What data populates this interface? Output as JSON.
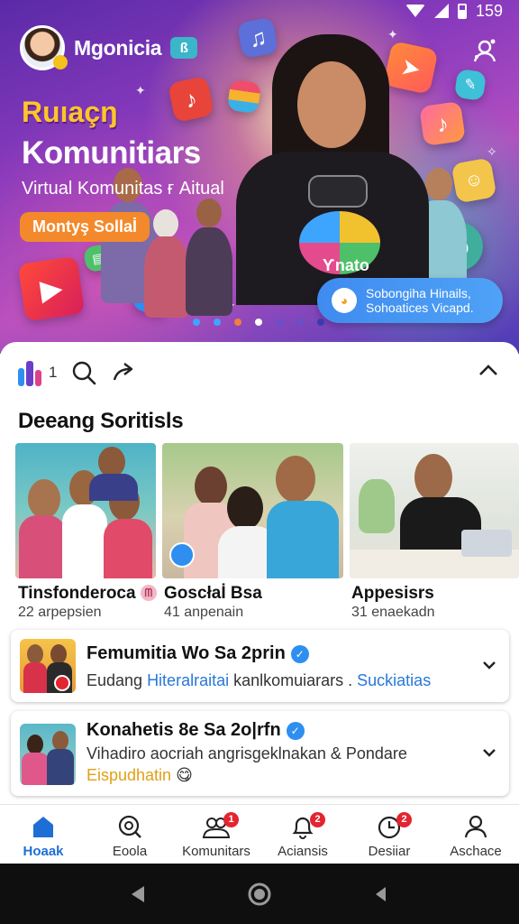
{
  "status_bar": {
    "time": "159"
  },
  "header": {
    "app_name": "Mgonicia",
    "badge_glyph": "ß"
  },
  "hero": {
    "title_line1": "Ruıaçŋ",
    "title_line2": "Komunitiars",
    "subtitle": "Virtual Komunitas ғ Aitual",
    "cta_label": "Montyş Sollaİ",
    "shirt_text": "Ƴnato",
    "card_text_line1": "Sobongiha Hinails,",
    "card_text_line2": "Sohoatices Vicapd.",
    "carousel": {
      "count": 7,
      "active_index": 4,
      "colors": [
        "#3ea5ff",
        "#3ea5ff",
        "#f0803c",
        "#ffffff",
        "#6a4fc7",
        "#6a4fc7",
        "#3b3bb0"
      ]
    }
  },
  "toolbar": {
    "count": "1"
  },
  "section": {
    "title": "Deeang Soritisls"
  },
  "cards": [
    {
      "title": "Tinsfonderoca",
      "title_badge": "ᗰ",
      "subtitle": "22 arpepsien"
    },
    {
      "title": "Goscłaİ Bsa",
      "subtitle": "41 anpenain"
    },
    {
      "title": "Appesisrs",
      "subtitle": "31 enaekadn"
    }
  ],
  "notifications": [
    {
      "title": "Femumitia Wo Sa 2prin",
      "text_plain": "Eudang ",
      "text_link": "Hiteralraitai",
      "text_rest": " kanlkomuiarars . ",
      "text_link2": "Suckiatias"
    },
    {
      "title": "Konahetis 8e Sa 2o|rfn",
      "line1": "Vihadiro aocriah angrisgeklnakan & Pondare",
      "line2": "Eispudhatin",
      "emoji": "😋"
    }
  ],
  "bottom_nav": [
    {
      "label": "Hoaak",
      "icon": "home-icon",
      "active": true
    },
    {
      "label": "Eoola",
      "icon": "search-icon"
    },
    {
      "label": "Komunitars",
      "icon": "community-icon",
      "badge": "1"
    },
    {
      "label": "Aciansis",
      "icon": "bell-icon",
      "badge": "2"
    },
    {
      "label": "Desiiar",
      "icon": "clock-icon",
      "badge": "2"
    },
    {
      "label": "Aschace",
      "icon": "profile-icon"
    }
  ],
  "colors": {
    "accent": "#1f6ed6",
    "badge": "#e32530",
    "cta": "#f4892b",
    "hero_purple": "#5a2aa8"
  }
}
